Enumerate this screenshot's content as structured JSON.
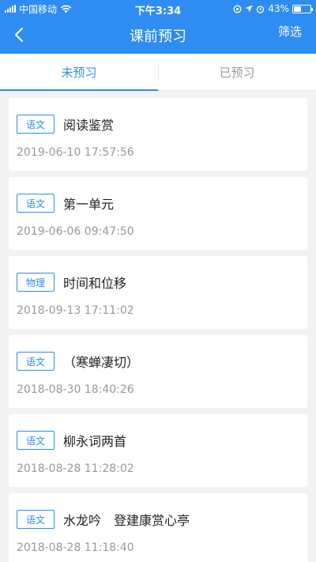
{
  "status_bar": {
    "carrier": "中国移动",
    "time": "下午3:34",
    "battery": "43%",
    "battery_level": 0.43,
    "icons": [
      "signal-icon",
      "wifi-icon",
      "location-lock-icon",
      "location-arrow-icon",
      "alarm-icon",
      "battery-icon"
    ]
  },
  "navbar": {
    "title": "课前预习",
    "filter_label": "筛选",
    "back_icon": "chevron-left-icon"
  },
  "tabs": [
    {
      "label": "未预习",
      "active": true
    },
    {
      "label": "已预习",
      "active": false
    }
  ],
  "items": [
    {
      "subject": "语文",
      "title": "阅读鉴赏",
      "date": "2019-06-10 17:57:56"
    },
    {
      "subject": "语文",
      "title": "第一单元",
      "date": "2019-06-06 09:47:50"
    },
    {
      "subject": "物理",
      "title": "时间和位移",
      "date": "2018-09-13 17:11:02"
    },
    {
      "subject": "语文",
      "title": "（寒蝉凄切）",
      "date": "2018-08-30 18:40:26"
    },
    {
      "subject": "语文",
      "title": "柳永词两首",
      "date": "2018-08-28 11:28:02"
    },
    {
      "subject": "语文",
      "title": "水龙吟　登建康赏心亭",
      "date": "2018-08-28 11:18:40"
    }
  ],
  "colors": {
    "accent": "#2f8cf0",
    "background": "#f2f2f2"
  }
}
